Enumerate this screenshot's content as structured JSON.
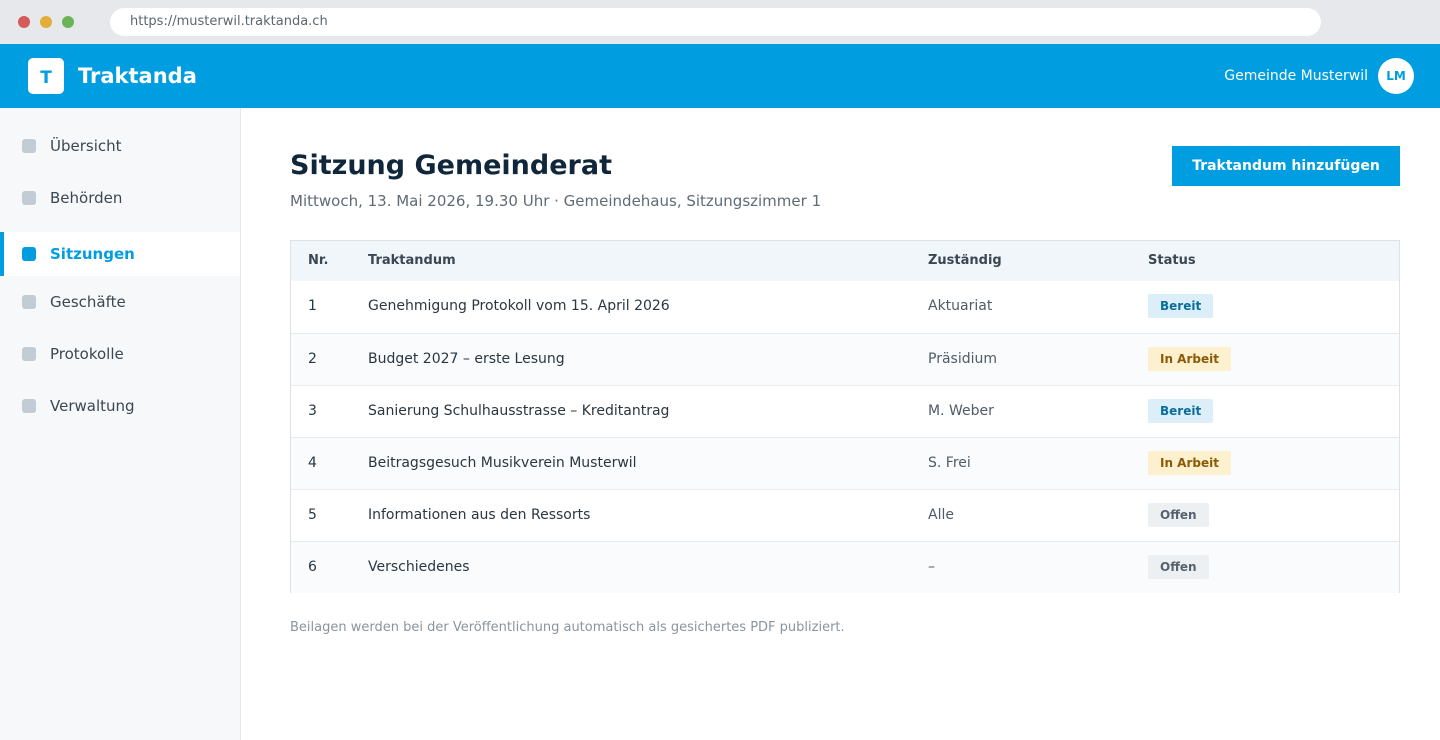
{
  "browser": {
    "url": "https://musterwil.traktanda.ch"
  },
  "header": {
    "logo_letter": "T",
    "app_name": "Traktanda",
    "org_name": "Gemeinde Musterwil",
    "avatar_initials": "LM"
  },
  "sidebar": {
    "items": [
      {
        "label": "Übersicht",
        "active": false
      },
      {
        "label": "Behörden",
        "active": false
      },
      {
        "label": "Sitzungen",
        "active": true
      },
      {
        "label": "Geschäfte",
        "active": false
      },
      {
        "label": "Protokolle",
        "active": false
      },
      {
        "label": "Verwaltung",
        "active": false
      }
    ]
  },
  "main": {
    "title": "Sitzung Gemeinderat",
    "subtitle": "Mittwoch, 13. Mai 2026, 19.30 Uhr · Gemeindehaus, Sitzungszimmer 1",
    "add_button_label": "Traktandum hinzufügen",
    "table": {
      "headers": [
        "Nr.",
        "Traktandum",
        "Zuständig",
        "Status"
      ],
      "rows": [
        {
          "nr": "1",
          "traktandum": "Genehmigung Protokoll vom 15. April 2026",
          "zustaendig": "Aktuariat",
          "status": "Bereit"
        },
        {
          "nr": "2",
          "traktandum": "Budget 2027 – erste Lesung",
          "zustaendig": "Präsidium",
          "status": "In Arbeit"
        },
        {
          "nr": "3",
          "traktandum": "Sanierung Schulhausstrasse – Kreditantrag",
          "zustaendig": "M. Weber",
          "status": "Bereit"
        },
        {
          "nr": "4",
          "traktandum": "Beitragsgesuch Musikverein Musterwil",
          "zustaendig": "S. Frei",
          "status": "In Arbeit"
        },
        {
          "nr": "5",
          "traktandum": "Informationen aus den Ressorts",
          "zustaendig": "Alle",
          "status": "Offen"
        },
        {
          "nr": "6",
          "traktandum": "Verschiedenes",
          "zustaendig": "–",
          "status": "Offen"
        }
      ]
    },
    "footnote": "Beilagen werden bei der Veröffentlichung automatisch als gesichertes PDF publiziert."
  },
  "colors": {
    "brand": "#009ee0",
    "bereit_bg": "#dceff9",
    "in_arbeit_bg": "#fdf0cf",
    "offen_bg": "#edf0f3"
  }
}
